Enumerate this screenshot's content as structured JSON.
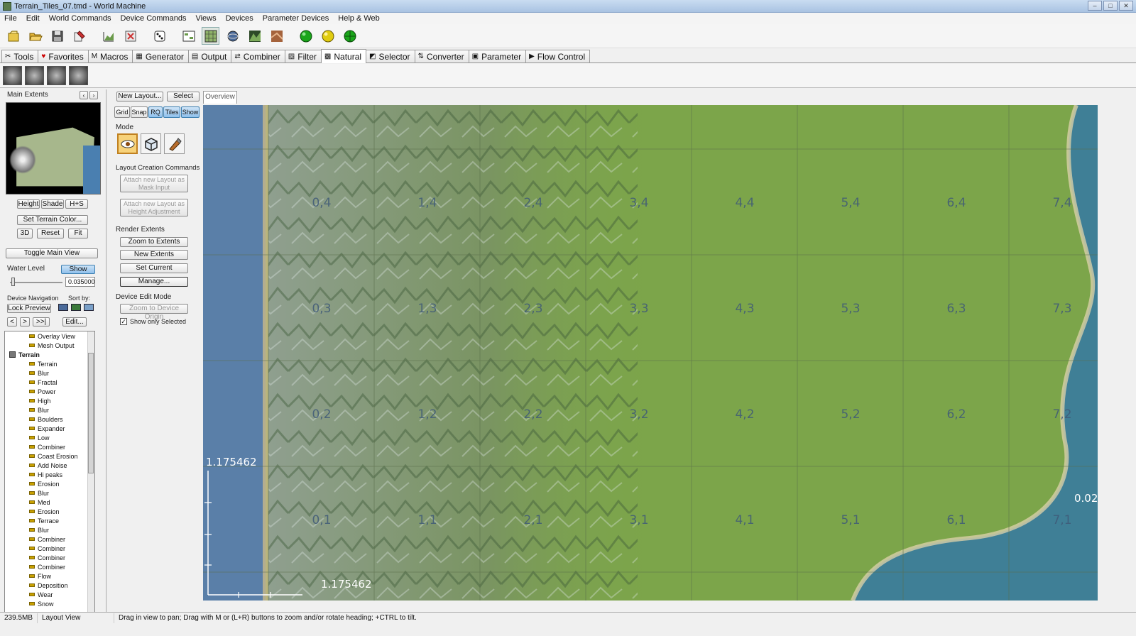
{
  "window": {
    "title": "Terrain_Tiles_07.tmd - World Machine",
    "controls": [
      "–",
      "□",
      "✕"
    ]
  },
  "menu": [
    "File",
    "Edit",
    "World Commands",
    "Device Commands",
    "Views",
    "Devices",
    "Parameter Devices",
    "Help & Web"
  ],
  "toolbar": {
    "icons": [
      "new-file-icon",
      "open-folder-icon",
      "save-icon",
      "save-as-icon",
      "build-icon",
      "build-selected-icon",
      "random-seed-icon",
      "device-view-icon",
      "layout-view-icon",
      "world-3d-icon",
      "terrain-view-icon",
      "texture-view-icon",
      "build-status-green-icon",
      "build-status-yellow-icon",
      "globe-icon"
    ]
  },
  "tabs": [
    {
      "label": "Tools",
      "glyph": "✂"
    },
    {
      "label": "Favorites",
      "glyph": "♥"
    },
    {
      "label": "Macros",
      "glyph": "M"
    },
    {
      "label": "Generator",
      "glyph": "▦"
    },
    {
      "label": "Output",
      "glyph": "▤"
    },
    {
      "label": "Combiner",
      "glyph": "⇄"
    },
    {
      "label": "Filter",
      "glyph": "▨"
    },
    {
      "label": "Natural",
      "glyph": "▩"
    },
    {
      "label": "Selector",
      "glyph": "◩"
    },
    {
      "label": "Converter",
      "glyph": "⇅"
    },
    {
      "label": "Parameter",
      "glyph": "▣"
    },
    {
      "label": "Flow Control",
      "glyph": "▶"
    }
  ],
  "active_tab": "Natural",
  "left": {
    "extents_title": "Main Extents",
    "view_buttons": [
      "Height",
      "Shade",
      "H+S"
    ],
    "set_color": "Set Terrain Color...",
    "row_buttons": [
      "3D",
      "Reset",
      "Fit"
    ],
    "toggle_main": "Toggle Main View",
    "water_label": "Water Level",
    "water_show": "Show",
    "water_value": "0.035000",
    "nav_label": "Device Navigation",
    "sort_label": "Sort by:",
    "lock_preview": "Lock Preview",
    "nav_buttons": [
      "<",
      ">",
      ">>|"
    ],
    "edit_button": "Edit...",
    "tree": [
      {
        "label": "Overlay View",
        "group": false
      },
      {
        "label": "Mesh Output",
        "group": false
      },
      {
        "label": "Terrain",
        "group": true
      },
      {
        "label": "Terrain",
        "group": false
      },
      {
        "label": "Blur",
        "group": false
      },
      {
        "label": "Fractal",
        "group": false
      },
      {
        "label": "Power",
        "group": false
      },
      {
        "label": "High",
        "group": false
      },
      {
        "label": "Blur",
        "group": false
      },
      {
        "label": "Boulders",
        "group": false
      },
      {
        "label": "Expander",
        "group": false
      },
      {
        "label": "Low",
        "group": false
      },
      {
        "label": "Combiner",
        "group": false
      },
      {
        "label": "Coast Erosion",
        "group": false
      },
      {
        "label": "Add Noise",
        "group": false
      },
      {
        "label": "Hi peaks",
        "group": false
      },
      {
        "label": "Erosion",
        "group": false
      },
      {
        "label": "Blur",
        "group": false
      },
      {
        "label": "Med",
        "group": false
      },
      {
        "label": "Erosion",
        "group": false
      },
      {
        "label": "Terrace",
        "group": false
      },
      {
        "label": "Blur",
        "group": false
      },
      {
        "label": "Combiner",
        "group": false
      },
      {
        "label": "Combiner",
        "group": false
      },
      {
        "label": "Combiner",
        "group": false
      },
      {
        "label": "Combiner",
        "group": false
      },
      {
        "label": "Flow",
        "group": false
      },
      {
        "label": "Deposition",
        "group": false
      },
      {
        "label": "Wear",
        "group": false
      },
      {
        "label": "Snow",
        "group": false
      }
    ]
  },
  "mid": {
    "new_layout": "New Layout...",
    "select": "Select",
    "toggles": [
      "Grid",
      "Snap",
      "RQ",
      "Tiles",
      "Show"
    ],
    "mode_label": "Mode",
    "layout_cmds_label": "Layout Creation Commands",
    "attach_mask": [
      "Attach new Layout as",
      "Mask Input"
    ],
    "attach_height": [
      "Attach new Layout as",
      "Height Adjustment"
    ],
    "render_label": "Render Extents",
    "render_buttons": [
      "Zoom to Extents",
      "New Extents",
      "Set Current",
      "Manage..."
    ],
    "device_edit_label": "Device Edit Mode",
    "zoom_device": "Zoom to Device Origin",
    "show_selected": "Show only Selected"
  },
  "view": {
    "tab": "Overview",
    "scale_vertical": "1.175462",
    "scale_horizontal": "1.175462",
    "edge_label": "0.02",
    "tiles": [
      [
        "0,4",
        "1,4",
        "2,4",
        "3,4",
        "4,4",
        "5,4",
        "6,4",
        "7,4"
      ],
      [
        "0,3",
        "1,3",
        "2,3",
        "3,3",
        "4,3",
        "5,3",
        "6,3",
        "7,3"
      ],
      [
        "0,2",
        "1,2",
        "2,2",
        "3,2",
        "4,2",
        "5,2",
        "6,2",
        "7,2"
      ],
      [
        "0,1",
        "1,1",
        "2,1",
        "3,1",
        "4,1",
        "5,1",
        "6,1",
        "7,1"
      ]
    ]
  },
  "status": {
    "memory": "239.5MB",
    "view": "Layout View",
    "hint": "Drag in view to pan; Drag with M or (L+R) buttons to zoom and/or rotate heading; +CTRL to tilt."
  },
  "colors": {
    "grass": "#7ca54a",
    "water": "#5a7fa8",
    "sea": "#3f7f96",
    "mountain": "#8f9f8f",
    "accent": "#8fc0ec"
  }
}
